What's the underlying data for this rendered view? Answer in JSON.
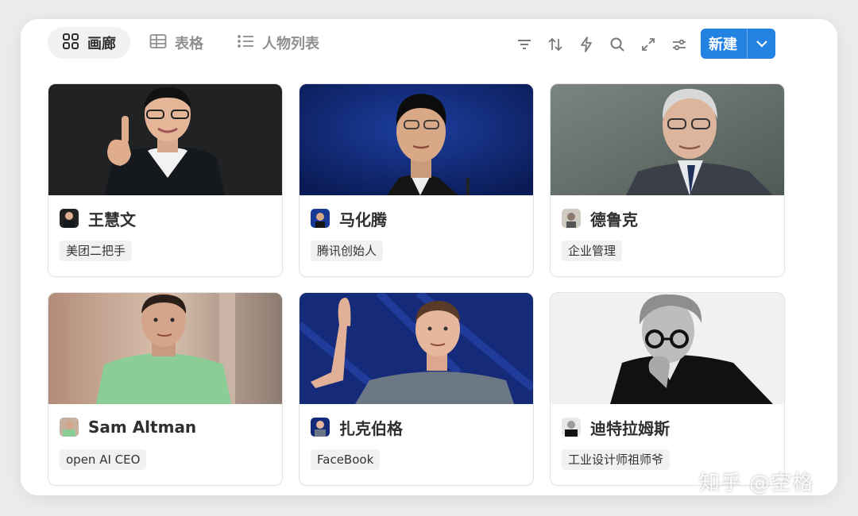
{
  "views": [
    {
      "label": "画廊",
      "icon": "gallery-grid-icon",
      "active": true
    },
    {
      "label": "表格",
      "icon": "table-icon",
      "active": false
    },
    {
      "label": "人物列表",
      "icon": "list-icon",
      "active": false
    }
  ],
  "toolbar": {
    "icons": [
      "filter-icon",
      "sort-icon",
      "automation-lightning-icon",
      "search-icon",
      "expand-icon",
      "settings-sliders-icon"
    ],
    "new_label": "新建"
  },
  "cards": [
    {
      "name": "王慧文",
      "tag": "美团二把手"
    },
    {
      "name": "马化腾",
      "tag": "腾讯创始人"
    },
    {
      "name": "德鲁克",
      "tag": "企业管理"
    },
    {
      "name": "Sam Altman",
      "tag": "open AI CEO"
    },
    {
      "name": "扎克伯格",
      "tag": "FaceBook"
    },
    {
      "name": "迪特拉姆斯",
      "tag": "工业设计师祖师爷"
    }
  ],
  "watermark": "知乎 @空格",
  "colors": {
    "accent": "#2383e2",
    "tag_bg": "#f1f1ef"
  }
}
